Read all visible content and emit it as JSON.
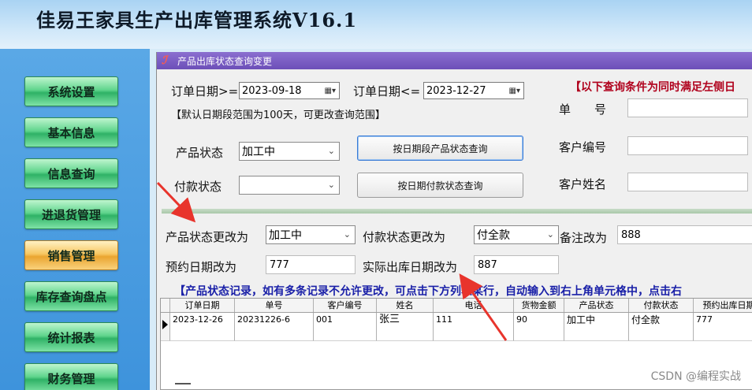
{
  "app": {
    "title": "佳易王家具生产出库管理系统V16.1"
  },
  "sidebar": {
    "items": [
      {
        "label": "系统设置",
        "active": false
      },
      {
        "label": "基本信息",
        "active": false
      },
      {
        "label": "信息查询",
        "active": false
      },
      {
        "label": "进退货管理",
        "active": false
      },
      {
        "label": "销售管理",
        "active": true
      },
      {
        "label": "库存查询盘点",
        "active": false
      },
      {
        "label": "统计报表",
        "active": false
      },
      {
        "label": "财务管理",
        "active": false
      }
    ]
  },
  "window": {
    "title": "产品出库状态查询变更",
    "icon": "app-logo-icon"
  },
  "query": {
    "date_from_label": "订单日期>=",
    "date_from_value": "2023-09-18",
    "date_to_label": "订单日期<=",
    "date_to_value": "2023-12-27",
    "red_note": "【以下查询条件为同时满足左侧日",
    "default_range_note": "【默认日期段范围为100天，可更改查询范围】",
    "product_status_label": "产品状态",
    "product_status_value": "加工中",
    "payment_status_label": "付款状态",
    "payment_status_value": "",
    "btn_query_product": "按日期段产品状态查询",
    "btn_query_payment": "按日期付款状态查询",
    "order_no_label": "单　　号",
    "customer_no_label": "客户编号",
    "customer_name_label": "客户姓名"
  },
  "edit": {
    "product_status_label": "产品状态更改为",
    "product_status_value": "加工中",
    "payment_status_label": "付款状态更改为",
    "payment_status_value": "付全款",
    "remark_label": "备注改为",
    "remark_value": "888",
    "appoint_date_label": "预约日期改为",
    "appoint_date_value": "777",
    "actual_date_label": "实际出库日期改为",
    "actual_date_value": "887"
  },
  "record_note": "【产品状态记录，如有多条记录不允许更改，可点击下方列表某行，自动输入到右上角单元格中，点击右",
  "table": {
    "columns": [
      "订单日期",
      "单号",
      "客户编号",
      "姓名",
      "电话",
      "货物金额",
      "产品状态",
      "付款状态",
      "预约出库日期"
    ],
    "rows": [
      [
        "2023-12-26",
        "20231226-6",
        "001",
        "张三",
        "111",
        "90",
        "加工中",
        "付全款",
        "777"
      ]
    ]
  },
  "watermark": "CSDN @编程实战",
  "colors": {
    "arrow": "#e8342c",
    "title_bar": "#6c4fb8",
    "nav_active": "#f7c762",
    "nav_default": "#5fd48c"
  }
}
